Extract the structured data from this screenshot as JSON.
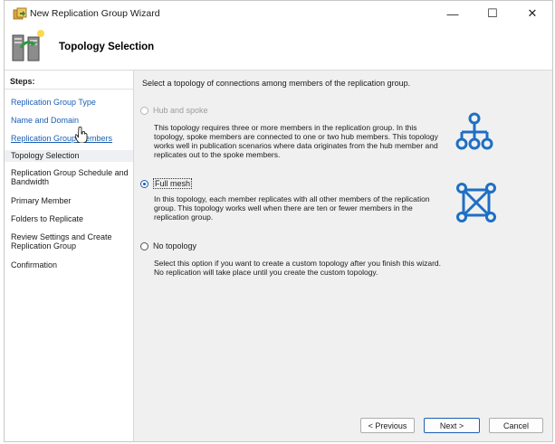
{
  "window": {
    "title": "New Replication Group Wizard",
    "controls": {
      "minimize": "—",
      "maximize": "☐",
      "close": "✕"
    }
  },
  "header": {
    "title": "Topology Selection"
  },
  "sidebar": {
    "steps_label": "Steps:",
    "items": [
      {
        "label": "Replication Group Type"
      },
      {
        "label": "Name and Domain"
      },
      {
        "label": "Replication Group Members"
      },
      {
        "label": "Topology Selection"
      },
      {
        "label": "Replication Group Schedule and Bandwidth"
      },
      {
        "label": "Primary Member"
      },
      {
        "label": "Folders to Replicate"
      },
      {
        "label": "Review Settings and Create Replication Group"
      },
      {
        "label": "Confirmation"
      }
    ]
  },
  "main": {
    "intro": "Select a topology of connections among members of the replication group.",
    "options": [
      {
        "label": "Hub and spoke",
        "description": "This topology requires three or more members in the replication group. In this topology, spoke members are connected to one or two hub members. This topology works well in publication scenarios where data originates from the hub member and replicates out to the spoke members."
      },
      {
        "label": "Full mesh",
        "description": "In this topology, each member replicates with all other members of the replication group. This topology works well when there are ten or fewer members in the replication group."
      },
      {
        "label": "No topology",
        "description": "Select this option if you want to create a custom topology after you finish this wizard. No replication will take place until you create the custom topology."
      }
    ]
  },
  "buttons": {
    "previous": "< Previous",
    "next": "Next >",
    "cancel": "Cancel"
  },
  "colors": {
    "link": "#1a5fb4",
    "diagram": "#1e6fc4",
    "content_bg": "#f0f0f0"
  }
}
